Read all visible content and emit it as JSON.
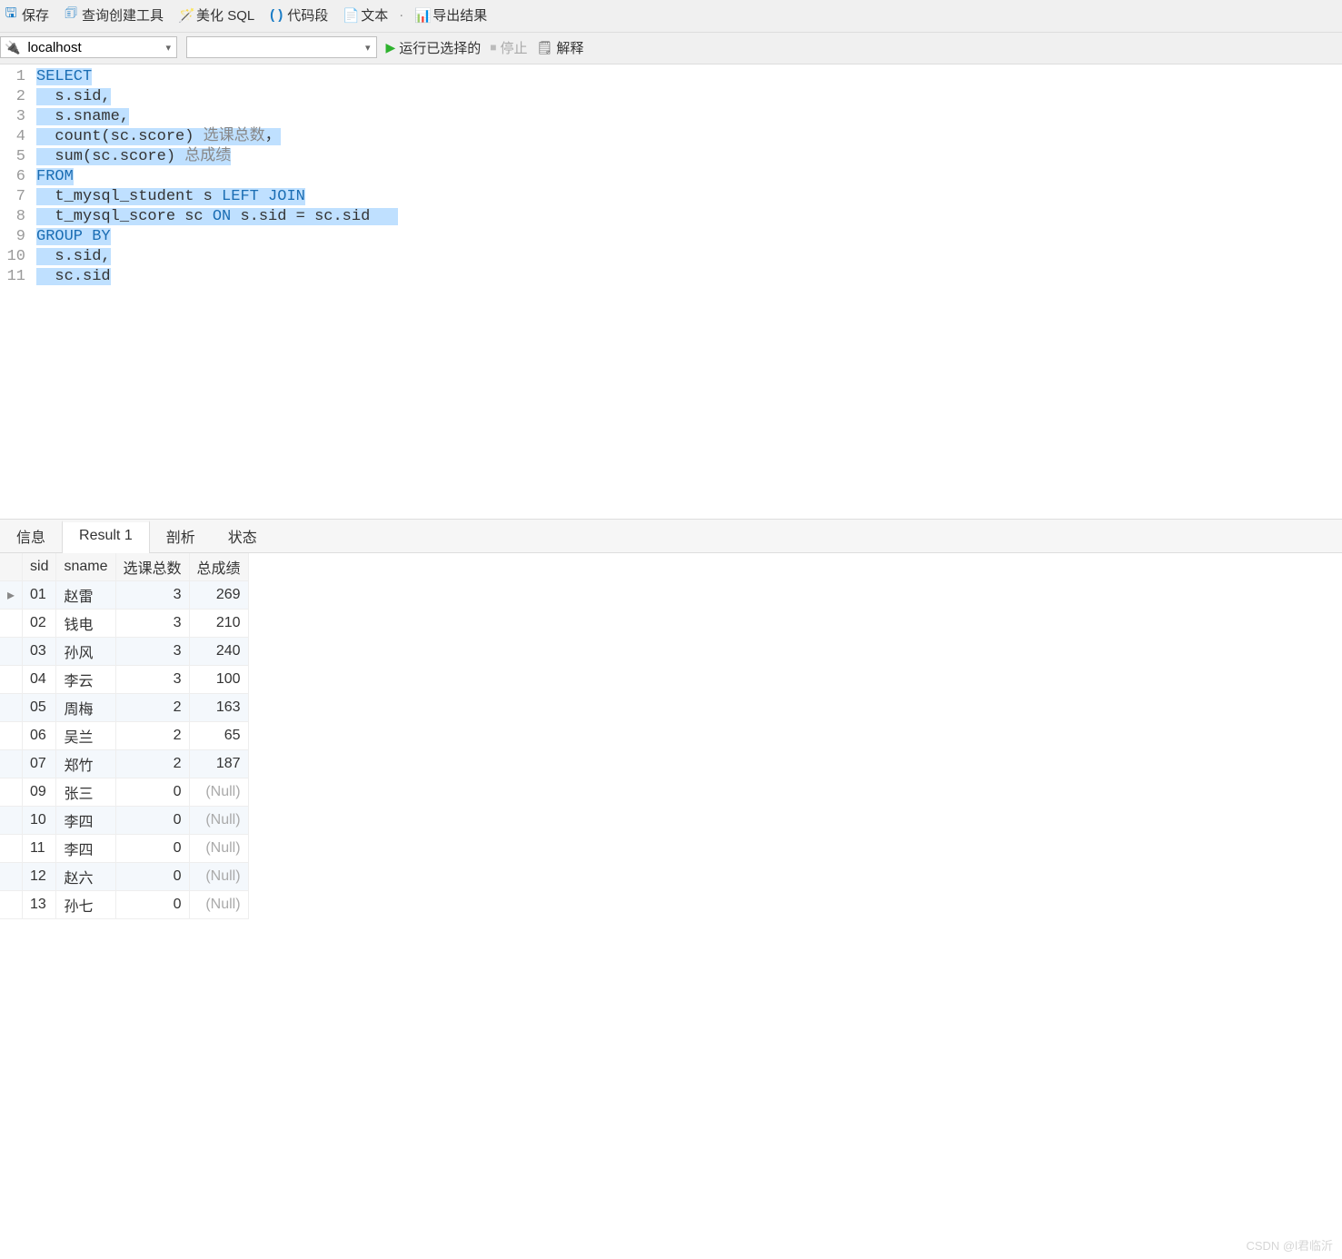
{
  "toolbar": {
    "save": "保存",
    "query_tool": "查询创建工具",
    "format_sql": "美化 SQL",
    "snippet": "代码段",
    "text": "文本",
    "export": "导出结果"
  },
  "conn": {
    "host": "localhost",
    "db": "",
    "run": "运行已选择的",
    "stop": "停止",
    "explain": "解释"
  },
  "sql_lines": [
    {
      "n": "1",
      "segs": [
        [
          "SELECT",
          "kw sel"
        ]
      ]
    },
    {
      "n": "2",
      "segs": [
        [
          "  s.sid,",
          "sel"
        ]
      ]
    },
    {
      "n": "3",
      "segs": [
        [
          "  s.sname,",
          "sel"
        ]
      ]
    },
    {
      "n": "4",
      "segs": [
        [
          "  count(sc.score) ",
          "sel"
        ],
        [
          "选课总数",
          "alias sel"
        ],
        [
          "，",
          "sel"
        ]
      ]
    },
    {
      "n": "5",
      "segs": [
        [
          "  sum(sc.score) ",
          "sel"
        ],
        [
          "总成绩",
          "alias sel"
        ]
      ]
    },
    {
      "n": "6",
      "segs": [
        [
          "FROM",
          "kw sel"
        ]
      ]
    },
    {
      "n": "7",
      "segs": [
        [
          "  t_mysql_student s ",
          "sel"
        ],
        [
          "LEFT JOIN",
          "kw sel"
        ]
      ]
    },
    {
      "n": "8",
      "segs": [
        [
          "  t_mysql_score sc ",
          "sel"
        ],
        [
          "ON",
          "kw sel"
        ],
        [
          " s.sid = sc.sid   ",
          "sel"
        ]
      ]
    },
    {
      "n": "9",
      "segs": [
        [
          "GROUP BY",
          "kw sel"
        ]
      ]
    },
    {
      "n": "10",
      "segs": [
        [
          "  s.sid,",
          "sel"
        ]
      ]
    },
    {
      "n": "11",
      "segs": [
        [
          "  sc.sid",
          "sel"
        ]
      ]
    }
  ],
  "tabs": {
    "info": "信息",
    "result": "Result 1",
    "profile": "剖析",
    "state": "状态",
    "active": "result"
  },
  "columns": [
    "sid",
    "sname",
    "选课总数",
    "总成绩"
  ],
  "rows": [
    {
      "sid": "01",
      "sname": "赵雷",
      "cnt": "3",
      "sum": "269",
      "ptr": true
    },
    {
      "sid": "02",
      "sname": "钱电",
      "cnt": "3",
      "sum": "210"
    },
    {
      "sid": "03",
      "sname": "孙风",
      "cnt": "3",
      "sum": "240"
    },
    {
      "sid": "04",
      "sname": "李云",
      "cnt": "3",
      "sum": "100"
    },
    {
      "sid": "05",
      "sname": "周梅",
      "cnt": "2",
      "sum": "163"
    },
    {
      "sid": "06",
      "sname": "吴兰",
      "cnt": "2",
      "sum": "65"
    },
    {
      "sid": "07",
      "sname": "郑竹",
      "cnt": "2",
      "sum": "187"
    },
    {
      "sid": "09",
      "sname": "张三",
      "cnt": "0",
      "sum": null
    },
    {
      "sid": "10",
      "sname": "李四",
      "cnt": "0",
      "sum": null
    },
    {
      "sid": "11",
      "sname": "李四",
      "cnt": "0",
      "sum": null
    },
    {
      "sid": "12",
      "sname": "赵六",
      "cnt": "0",
      "sum": null
    },
    {
      "sid": "13",
      "sname": "孙七",
      "cnt": "0",
      "sum": null
    }
  ],
  "null_text": "(Null)",
  "watermark": "CSDN @l君临沂"
}
